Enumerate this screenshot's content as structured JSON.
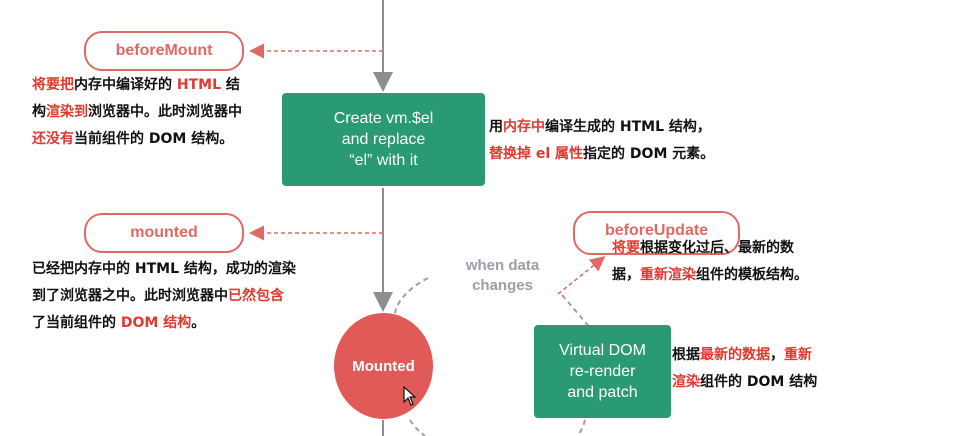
{
  "hooks": {
    "before_mount": "beforeMount",
    "mounted": "mounted",
    "before_update": "beforeUpdate"
  },
  "boxes": {
    "create_el": [
      "Create vm.$el",
      "and replace",
      "“el” with it"
    ],
    "virtual_dom": [
      "Virtual DOM",
      "re-render",
      "and patch"
    ]
  },
  "circle": {
    "mounted_state": "Mounted"
  },
  "when_changes": [
    "when data",
    "changes"
  ],
  "notes": {
    "before_mount": [
      [
        {
          "t": "将要把",
          "red": true
        },
        {
          "t": "内存中编译好的 ",
          "red": false
        },
        {
          "t": "HTML",
          "red": true
        },
        {
          "t": " 结",
          "red": false
        }
      ],
      [
        {
          "t": "构",
          "red": false
        },
        {
          "t": "渲染到",
          "red": true
        },
        {
          "t": "浏览器中。此时浏览器中",
          "red": false
        }
      ],
      [
        {
          "t": "还没有",
          "red": true
        },
        {
          "t": "当前组件的 DOM 结构。",
          "red": false
        }
      ]
    ],
    "create_el": [
      [
        {
          "t": "用",
          "red": false
        },
        {
          "t": "内存中",
          "red": true
        },
        {
          "t": "编译生成的 HTML 结构，",
          "red": false
        }
      ],
      [
        {
          "t": "替换掉 el 属性",
          "red": true
        },
        {
          "t": "指定的 DOM 元素。",
          "red": false
        }
      ]
    ],
    "mounted": [
      [
        {
          "t": "已经把内存中的 HTML 结构，成功的渲染",
          "red": false
        }
      ],
      [
        {
          "t": "到了浏览器之中。此时浏览器中",
          "red": false
        },
        {
          "t": "已然包含",
          "red": true
        }
      ],
      [
        {
          "t": "了当前组件的 ",
          "red": false
        },
        {
          "t": "DOM 结构",
          "red": true
        },
        {
          "t": "。",
          "red": false
        }
      ]
    ],
    "before_update": [
      [
        {
          "t": "将要",
          "red": true
        },
        {
          "t": "根据变化过后、最新的数",
          "red": false
        }
      ],
      [
        {
          "t": "据，",
          "red": false
        },
        {
          "t": "重新渲染",
          "red": true
        },
        {
          "t": "组件的模板结构。",
          "red": false
        }
      ]
    ],
    "virtual_dom": [
      [
        {
          "t": "根据",
          "red": false
        },
        {
          "t": "最新的数据",
          "red": true
        },
        {
          "t": "，",
          "red": false
        },
        {
          "t": "重新",
          "red": true
        }
      ],
      [
        {
          "t": "渲染",
          "red": true
        },
        {
          "t": "组件的 DOM 结构",
          "red": false
        }
      ]
    ]
  },
  "colors": {
    "green": "#2a9a73",
    "red": "#e06a63",
    "highlight": "#e0392f",
    "gray_line": "#8a8f94"
  }
}
